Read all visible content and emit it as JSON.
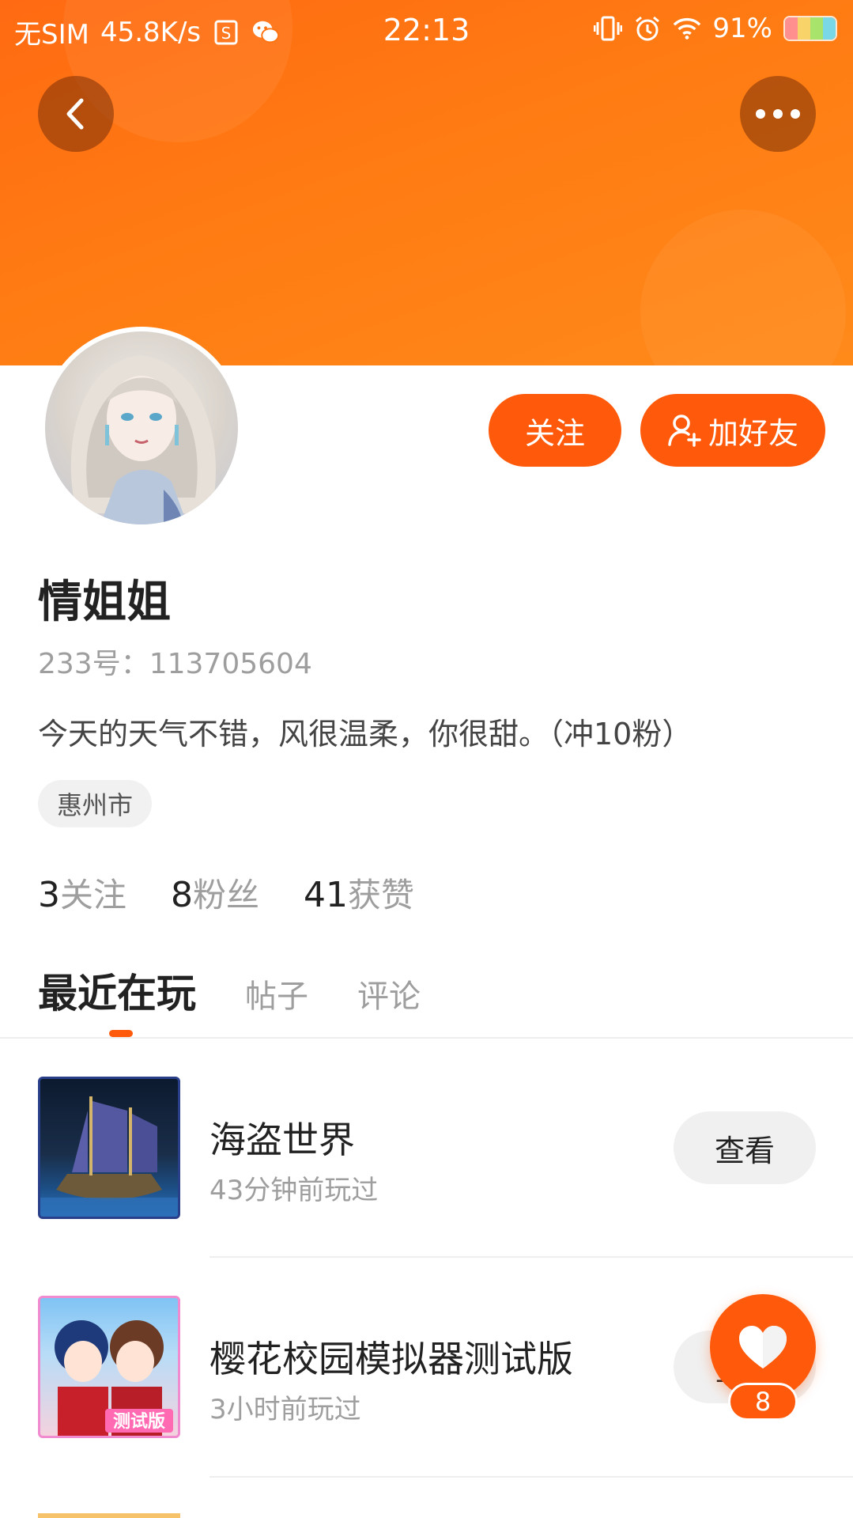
{
  "status_bar": {
    "carrier": "无SIM",
    "speed": "45.8K/s",
    "time": "22:13",
    "battery": "91%",
    "icons": [
      "sim-status-icon",
      "wechat-icon",
      "vibrate-icon",
      "alarm-icon",
      "wifi-icon",
      "battery-icon"
    ]
  },
  "header": {
    "back_icon": "chevron-left-icon",
    "more_icon": "more-horizontal-icon",
    "banner_color": "#ff6a12"
  },
  "actions": {
    "follow_label": "关注",
    "add_friend_label": "加好友",
    "accent": "#ff5a0c"
  },
  "profile": {
    "name": "情姐姐",
    "uid": "233号：113705604",
    "bio": "今天的天气不错，风很温柔，你很甜。（冲10粉）",
    "location": "惠州市"
  },
  "stats": [
    {
      "num": "3",
      "label": "关注"
    },
    {
      "num": "8",
      "label": "粉丝"
    },
    {
      "num": "41",
      "label": "获赞"
    }
  ],
  "tabs": [
    {
      "label": "最近在玩",
      "active": true
    },
    {
      "label": "帖子",
      "active": false
    },
    {
      "label": "评论",
      "active": false
    }
  ],
  "games": [
    {
      "title": "海盗世界",
      "subtitle": "43分钟前玩过",
      "button": "查看"
    },
    {
      "title": "樱花校园模拟器测试版",
      "subtitle": "3小时前玩过",
      "button": "查看"
    }
  ],
  "like": {
    "icon": "heart-icon",
    "count": "8"
  }
}
